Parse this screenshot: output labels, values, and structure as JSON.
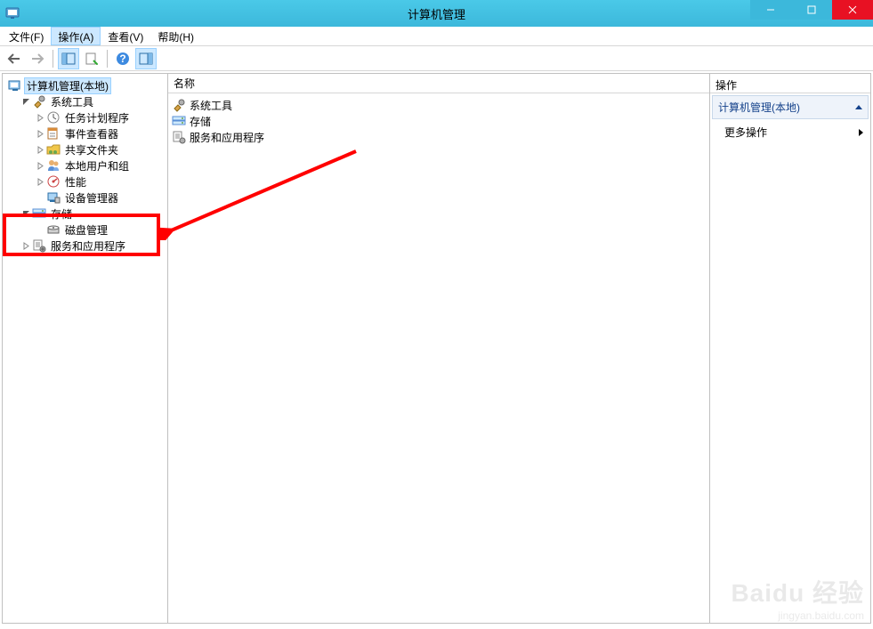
{
  "window": {
    "title": "计算机管理"
  },
  "menubar": {
    "items": [
      {
        "label": "文件(F)"
      },
      {
        "label": "操作(A)"
      },
      {
        "label": "查看(V)"
      },
      {
        "label": "帮助(H)"
      }
    ],
    "active_index": 1
  },
  "tree": {
    "root": "计算机管理(本地)",
    "system_tools": "系统工具",
    "task_scheduler": "任务计划程序",
    "event_viewer": "事件查看器",
    "shared_folders": "共享文件夹",
    "local_users": "本地用户和组",
    "performance": "性能",
    "device_manager": "设备管理器",
    "storage": "存储",
    "disk_management": "磁盘管理",
    "services_apps": "服务和应用程序"
  },
  "mid": {
    "column_header": "名称",
    "items": [
      {
        "label": "系统工具",
        "icon": "tools-icon"
      },
      {
        "label": "存储",
        "icon": "storage-icon"
      },
      {
        "label": "服务和应用程序",
        "icon": "services-icon"
      }
    ]
  },
  "actions": {
    "header": "操作",
    "group_label": "计算机管理(本地)",
    "more_actions": "更多操作"
  },
  "watermark": {
    "brand": "Baidu 经验",
    "url": "jingyan.baidu.com"
  }
}
